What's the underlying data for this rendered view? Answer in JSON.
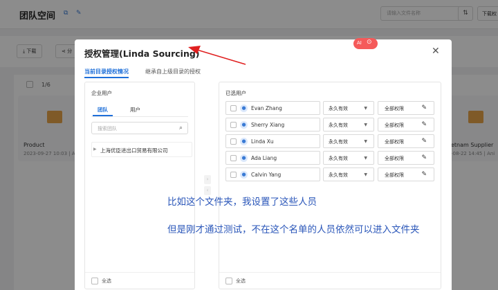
{
  "app": {
    "title": "团队空间",
    "search_placeholder": "请输入文件名称",
    "download_top_label": "下载权",
    "toolbar": {
      "download_label": "下载",
      "share_label": "分"
    },
    "page_indicator": "1/6",
    "cards": [
      {
        "name": "Product",
        "meta": "2023-09-27 10:03 | An"
      },
      {
        "name": "etnam Supplier",
        "meta": "-08-22 14:45 | Ani"
      }
    ]
  },
  "modal": {
    "title": "授权管理(Linda Sourcing)",
    "ai_badge": "AI",
    "tabs": [
      {
        "label": "当前目录授权情况"
      },
      {
        "label": "继承自上级目录的授权"
      }
    ],
    "left_panel": {
      "title": "企业用户",
      "sub_tabs": [
        {
          "label": "团队"
        },
        {
          "label": "用户"
        }
      ],
      "search_placeholder": "搜索团队",
      "tree_node": "上海优臣进出口贸易有限公司",
      "select_all_label": "全选"
    },
    "right_panel": {
      "title": "已选用户",
      "select_all_label": "全选",
      "users": [
        {
          "name": "Evan Zhang",
          "validity": "永久有效",
          "permission": "全部权限"
        },
        {
          "name": "Sherry Xiang",
          "validity": "永久有效",
          "permission": "全部权限"
        },
        {
          "name": "Linda Xu",
          "validity": "永久有效",
          "permission": "全部权限"
        },
        {
          "name": "Ada Liang",
          "validity": "永久有效",
          "permission": "全部权限"
        },
        {
          "name": "Calvin Yang",
          "validity": "永久有效",
          "permission": "全部权限"
        }
      ]
    }
  },
  "annotations": {
    "line1": "比如这个文件夹，我设置了这些人员",
    "line2": "但是刚才通过测试，不在这个名单的人员依然可以进入文件夹",
    "arrow_color": "#e02020",
    "text_color": "#2a56b9"
  },
  "colors": {
    "accent": "#1e6fd9",
    "folder": "#e8a44a",
    "badge": "#f55a5a"
  }
}
